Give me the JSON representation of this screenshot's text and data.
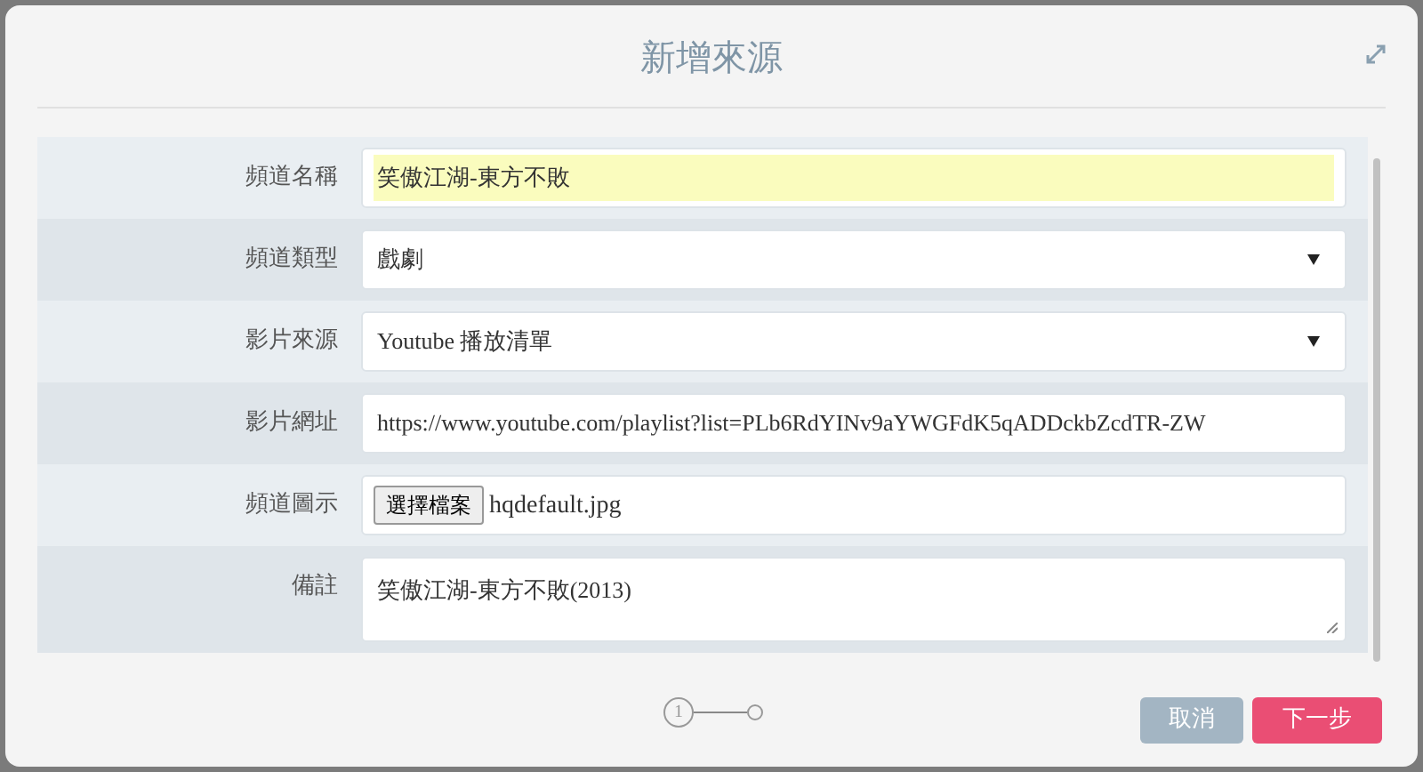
{
  "dialog": {
    "title": "新增來源"
  },
  "fields": [
    {
      "kind": "text",
      "label": "頻道名稱",
      "value": "笑傲江湖-東方不敗",
      "highlighted": true
    },
    {
      "kind": "select",
      "label": "頻道類型",
      "value": "戲劇"
    },
    {
      "kind": "select",
      "label": "影片來源",
      "value": "Youtube 播放清單"
    },
    {
      "kind": "text",
      "label": "影片網址",
      "value": "https://www.youtube.com/playlist?list=PLb6RdYINv9aYWGFdK5qADDckbZcdTR-ZW",
      "highlighted": false
    },
    {
      "kind": "file",
      "label": "頻道圖示",
      "button": "選擇檔案",
      "value": "hqdefault.jpg"
    },
    {
      "kind": "textarea",
      "label": "備註",
      "value": "笑傲江湖-東方不敗(2013)"
    }
  ],
  "steps": [
    {
      "label": "1",
      "selected": true
    },
    {
      "selected": false
    }
  ],
  "buttons": [
    {
      "kind": "cancel",
      "label": "取消"
    },
    {
      "kind": "primary",
      "label": "下一步"
    }
  ]
}
